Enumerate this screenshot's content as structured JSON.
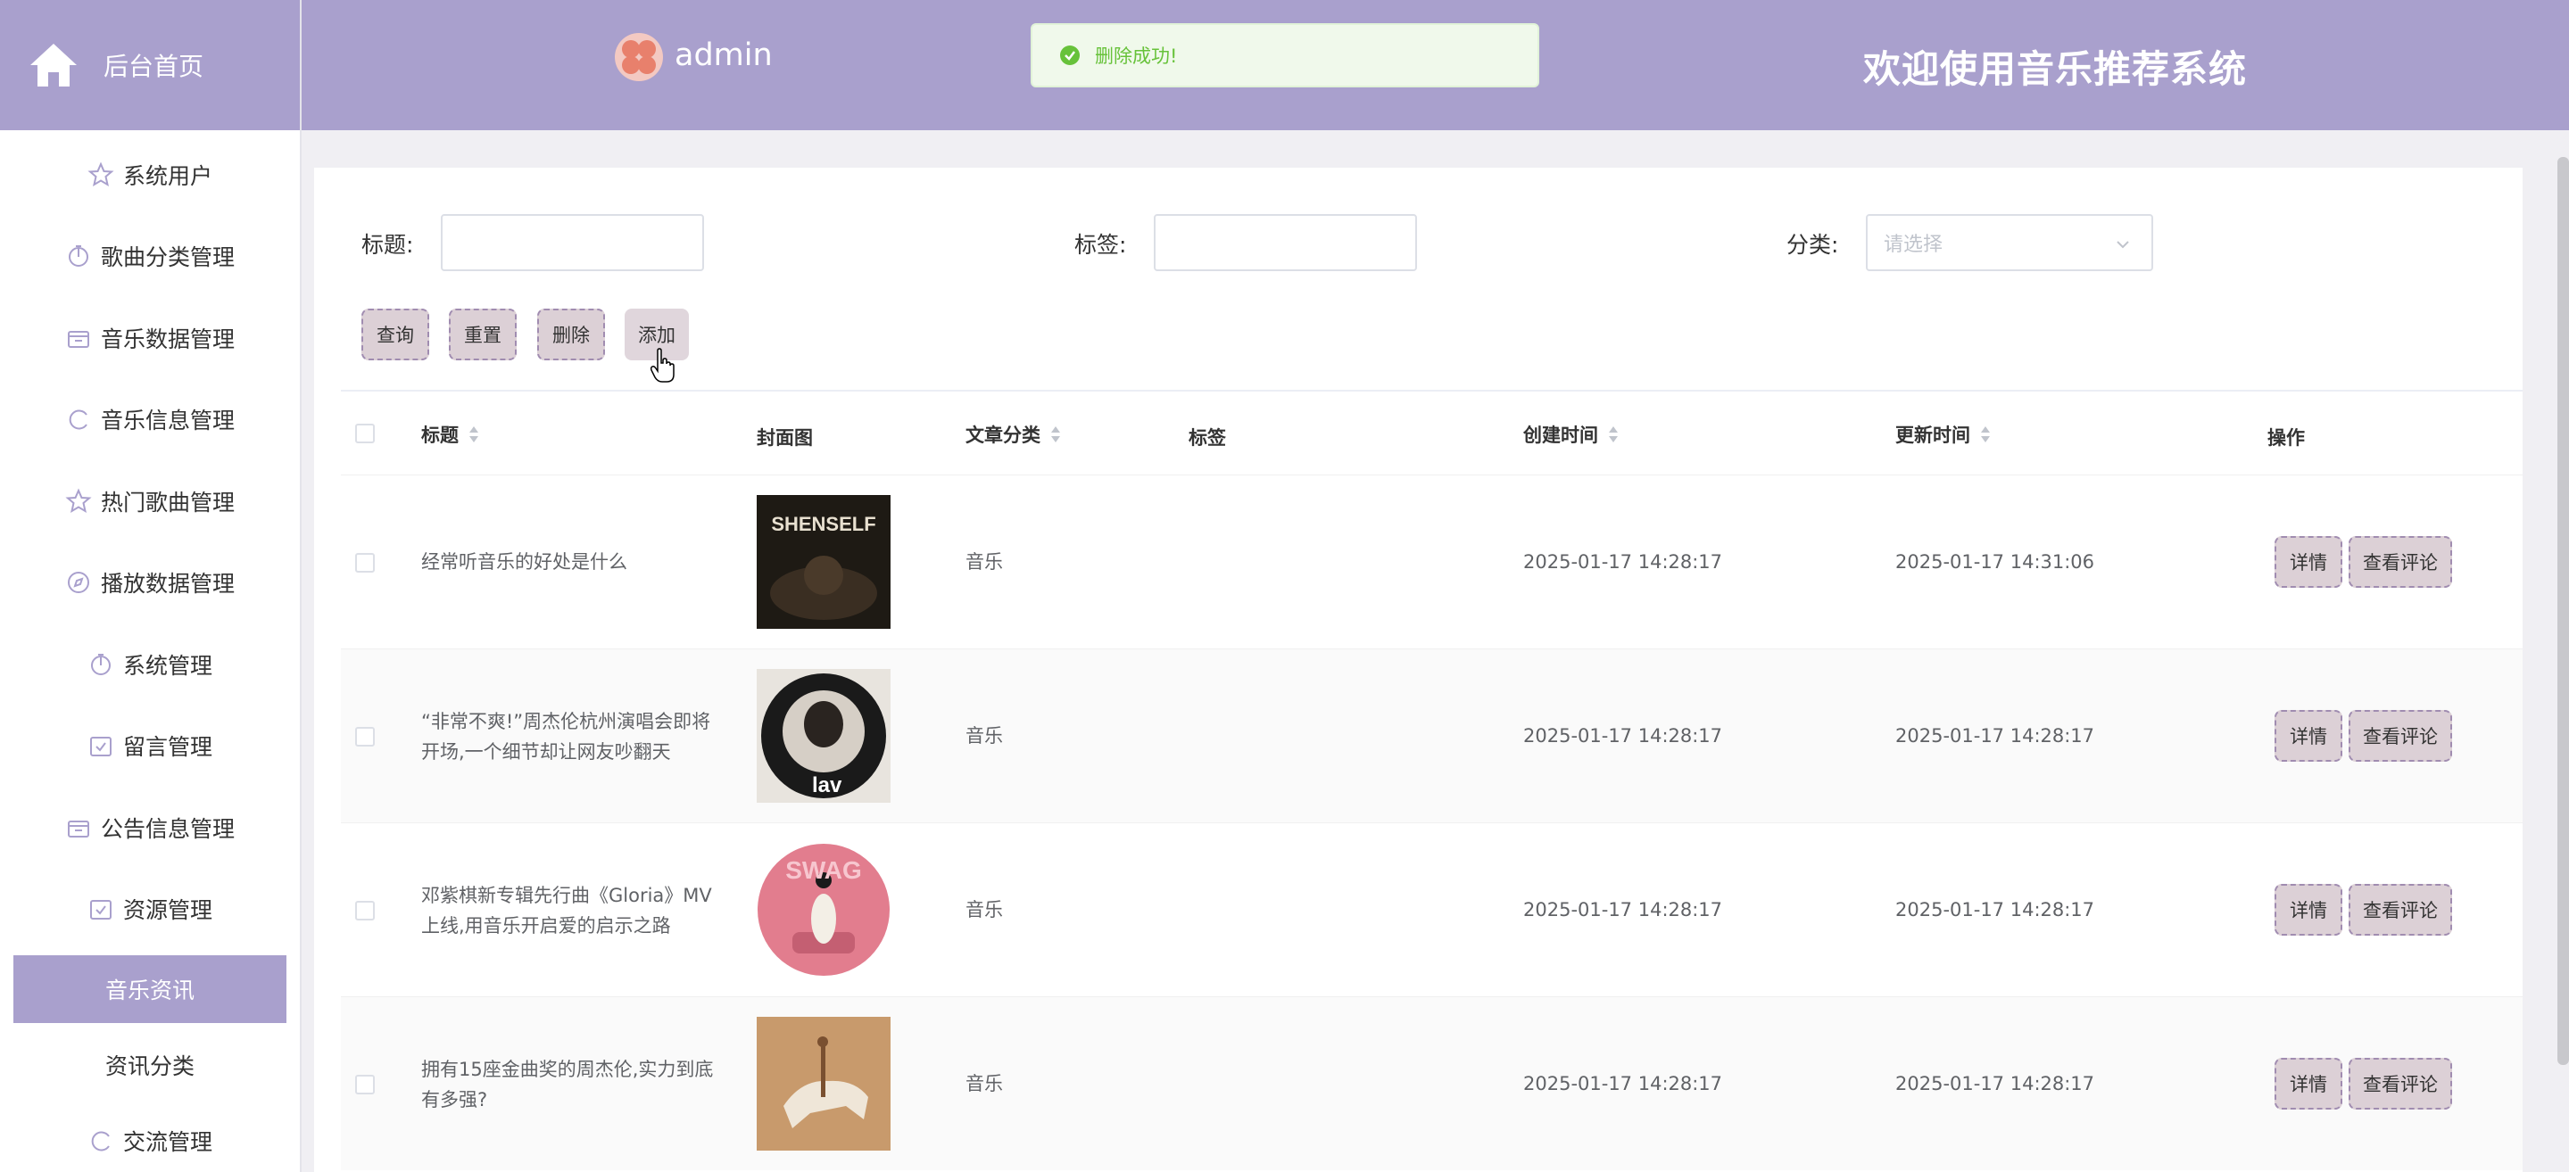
{
  "header": {
    "home_label": "后台首页",
    "admin_name": "admin",
    "welcome": "欢迎使用音乐推荐系统"
  },
  "toast": {
    "text": "删除成功!"
  },
  "sidebar": {
    "items": [
      {
        "label": "系统用户",
        "icon": "star-icon"
      },
      {
        "label": "歌曲分类管理",
        "icon": "timer-icon"
      },
      {
        "label": "音乐数据管理",
        "icon": "box-icon"
      },
      {
        "label": "音乐信息管理",
        "icon": "cycle-icon"
      },
      {
        "label": "热门歌曲管理",
        "icon": "star-icon"
      },
      {
        "label": "播放数据管理",
        "icon": "compass-icon"
      },
      {
        "label": "系统管理",
        "icon": "timer-icon"
      },
      {
        "label": "留言管理",
        "icon": "calendar-check-icon"
      },
      {
        "label": "公告信息管理",
        "icon": "box-icon"
      },
      {
        "label": "资源管理",
        "icon": "calendar-check-icon"
      },
      {
        "label": "音乐资讯",
        "active": true
      },
      {
        "label": "资讯分类"
      },
      {
        "label": "交流管理",
        "icon": "cycle-icon"
      }
    ]
  },
  "filters": {
    "title_label": "标题:",
    "tag_label": "标签:",
    "category_label": "分类:",
    "category_placeholder": "请选择"
  },
  "buttons": {
    "query": "查询",
    "reset": "重置",
    "delete": "删除",
    "add": "添加"
  },
  "table": {
    "headers": {
      "title": "标题",
      "cover": "封面图",
      "category": "文章分类",
      "tags": "标签",
      "created": "创建时间",
      "updated": "更新时间",
      "actions": "操作"
    },
    "rows": [
      {
        "title": "经常听音乐的好处是什么",
        "category": "音乐",
        "tags": "",
        "created": "2025-01-17 14:28:17",
        "updated": "2025-01-17 14:31:06"
      },
      {
        "title": "“非常不爽!”周杰伦杭州演唱会即将开场,一个细节却让网友吵翻天",
        "category": "音乐",
        "tags": "",
        "created": "2025-01-17 14:28:17",
        "updated": "2025-01-17 14:28:17"
      },
      {
        "title": "邓紫棋新专辑先行曲《Gloria》MV上线,用音乐开启爱的启示之路",
        "category": "音乐",
        "tags": "",
        "created": "2025-01-17 14:28:17",
        "updated": "2025-01-17 14:28:17"
      },
      {
        "title": "拥有15座金曲奖的周杰伦,实力到底有多强?",
        "category": "音乐",
        "tags": "",
        "created": "2025-01-17 14:28:17",
        "updated": "2025-01-17 14:28:17"
      }
    ],
    "row_actions": {
      "detail": "详情",
      "comments": "查看评论"
    }
  },
  "cover_texts": {
    "c1": "SHENSELF",
    "c2": "lav",
    "c3": "SWAG"
  },
  "colors": {
    "accent": "#a9a0cd",
    "button_bg": "#dcd0d6",
    "success": "#67c23a"
  }
}
